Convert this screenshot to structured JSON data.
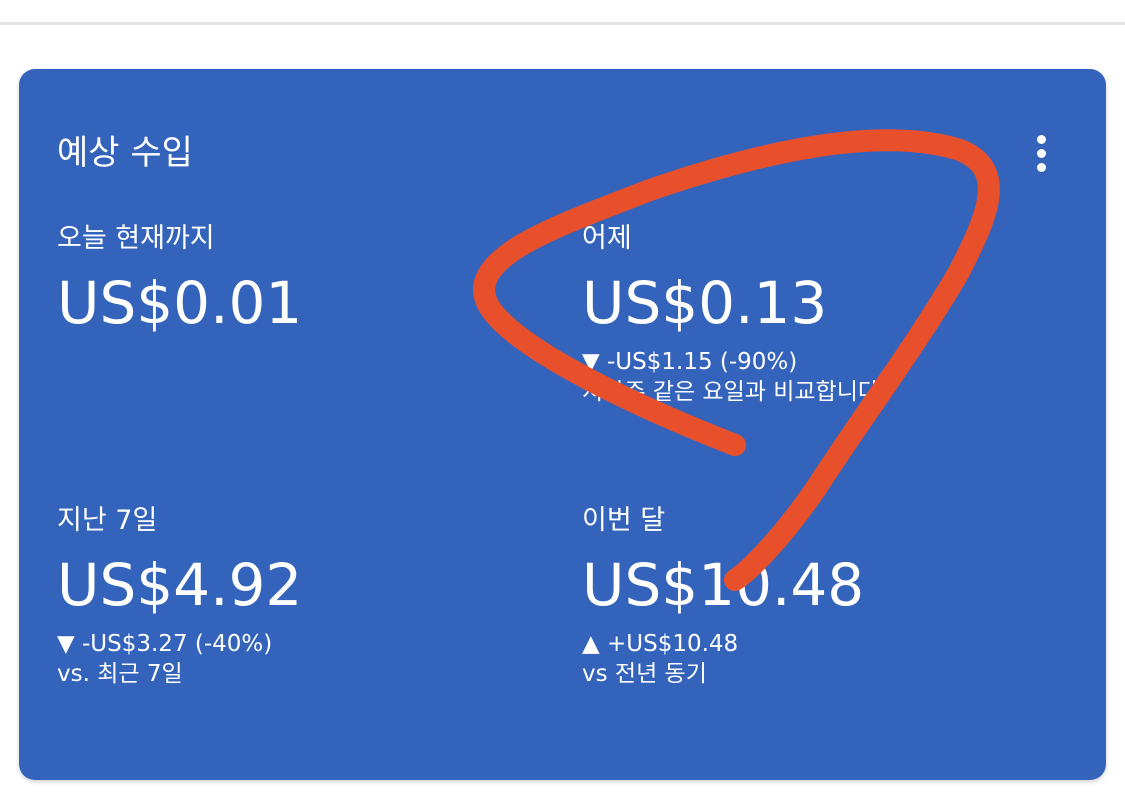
{
  "colors": {
    "card_background": "#3463bc",
    "text": "#ffffff",
    "annotation_stroke": "#e8502c"
  },
  "card": {
    "title": "예상 수입",
    "menu_icon": "more-vert-icon"
  },
  "metrics": {
    "today": {
      "label": "오늘 현재까지",
      "value": "US$0.01"
    },
    "yesterday": {
      "label": "어제",
      "value": "US$0.13",
      "change": "▼ -US$1.15 (-90%)",
      "note": "지난주 같은 요일과 비교합니다."
    },
    "last7": {
      "label": "지난 7일",
      "value": "US$4.92",
      "change": "▼ -US$3.27 (-40%)",
      "note": "vs. 최근 7일"
    },
    "month": {
      "label": "이번 달",
      "value": "US$10.48",
      "change": "▲ +US$10.48",
      "note": "vs 전년 동기"
    }
  }
}
